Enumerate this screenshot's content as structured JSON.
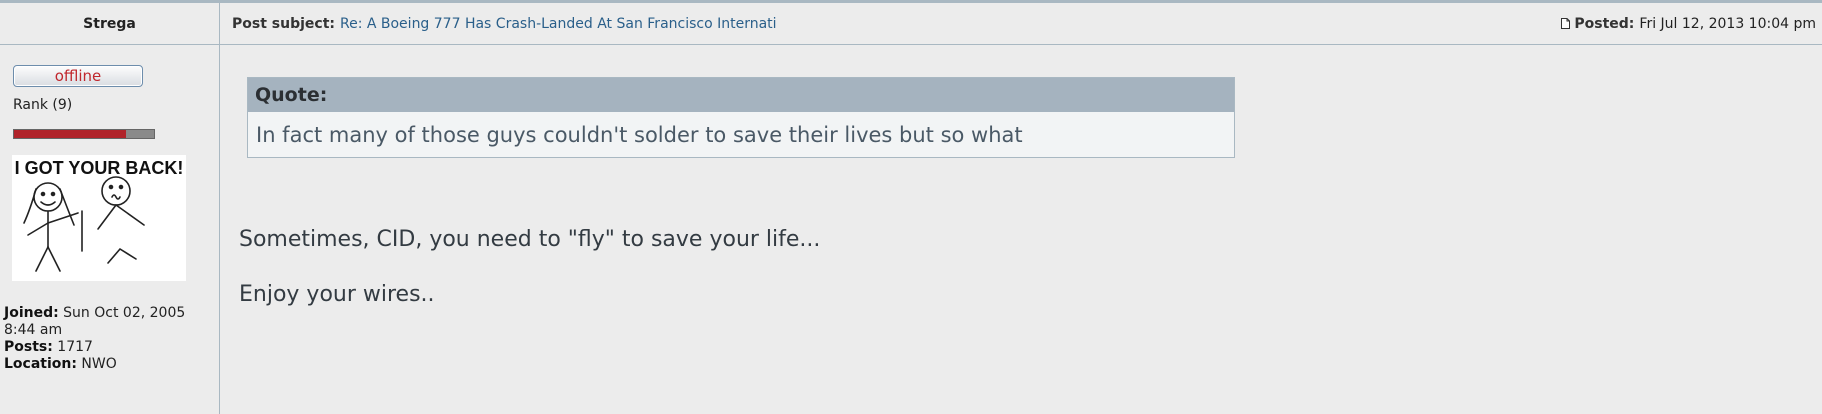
{
  "author": {
    "name": "Strega"
  },
  "post": {
    "subject_label": "Post subject:",
    "subject": "Re: A Boeing 777 Has Crash-Landed At San Francisco Internati",
    "posted_label": "Posted:",
    "posted": "Fri Jul 12, 2013 10:04 pm",
    "quote": {
      "label": "Quote:",
      "text": "In fact many of those guys couldn't solder to save their lives but so what"
    },
    "paragraphs": [
      "Sometimes, CID, you need to \"fly\" to save your life...",
      "Enjoy your wires.."
    ]
  },
  "profile": {
    "status": "offline",
    "rank": "Rank (9)",
    "rank_level": 0.8,
    "avatar_text": "I GOT YOUR BACK!",
    "joined_label": "Joined:",
    "joined": "Sun Oct 02, 2005 8:44 am",
    "posts_label": "Posts:",
    "posts": "1717",
    "location_label": "Location:",
    "location": "NWO"
  },
  "colors": {
    "link": "#2a5f8a",
    "status_offline": "#c0272d",
    "rank_fill": "#b0232a",
    "quote_header": "#a5b3bf"
  },
  "icons": {
    "posted": "document-icon"
  }
}
